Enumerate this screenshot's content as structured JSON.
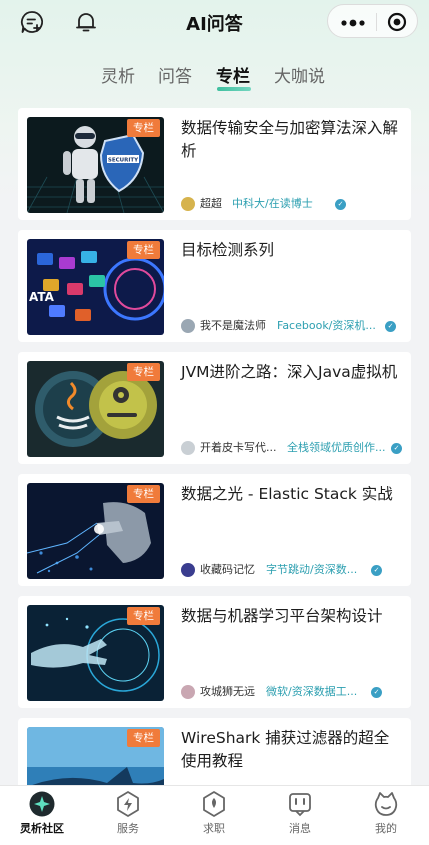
{
  "header": {
    "title": "AI问答",
    "left_icons": [
      "add-chat-icon",
      "bell-icon"
    ],
    "capsule_icons": [
      "more-dots-icon",
      "target-icon"
    ]
  },
  "categories": [
    {
      "label": "灵析",
      "active": false
    },
    {
      "label": "问答",
      "active": false
    },
    {
      "label": "专栏",
      "active": true
    },
    {
      "label": "大咖说",
      "active": false
    }
  ],
  "accent_color": "#3fbf9f",
  "badge_color": "#f07b3b",
  "columns": [
    {
      "badge": "专栏",
      "title": "数据传输安全与加密算法深入解析",
      "author": "超超",
      "org": "中科大/在读博士",
      "verified": true
    },
    {
      "badge": "专栏",
      "title": "目标检测系列",
      "author": "我不是魔法师",
      "org": "Facebook/资深机...",
      "verified": true
    },
    {
      "badge": "专栏",
      "title": "JVM进阶之路：深入Java虚拟机",
      "author": "开着皮卡写代...",
      "org": "全栈领域优质创作...",
      "verified": true
    },
    {
      "badge": "专栏",
      "title": "数据之光 - Elastic Stack 实战",
      "author": "收藏码记忆",
      "org": "字节跳动/资深数...",
      "verified": true
    },
    {
      "badge": "专栏",
      "title": "数据与机器学习平台架构设计",
      "author": "攻城狮无远",
      "org": "微软/资深数据工...",
      "verified": true
    },
    {
      "badge": "专栏",
      "title": "WireShark 捕获过滤器的超全使用教程",
      "author": "",
      "org": "",
      "verified": false
    }
  ],
  "nav": [
    {
      "label": "灵析社区",
      "icon": "sparkle-icon",
      "active": true
    },
    {
      "label": "服务",
      "icon": "lightning-icon",
      "active": false
    },
    {
      "label": "求职",
      "icon": "briefcase-icon",
      "active": false
    },
    {
      "label": "消息",
      "icon": "message-icon",
      "active": false
    },
    {
      "label": "我的",
      "icon": "profile-icon",
      "active": false
    }
  ]
}
